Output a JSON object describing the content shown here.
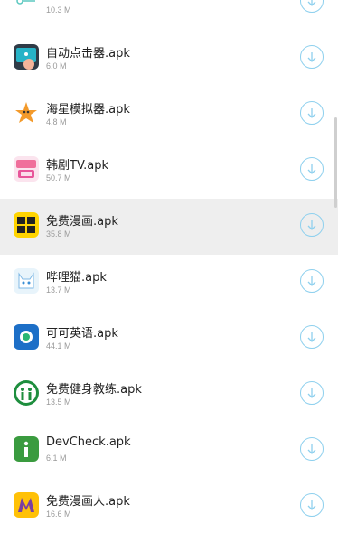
{
  "files": [
    {
      "name": "",
      "size": "10.3 M",
      "icon": "dots-icon"
    },
    {
      "name": "自动点击器.apk",
      "size": "6.0 M",
      "icon": "auto-clicker-icon"
    },
    {
      "name": "海星模拟器.apk",
      "size": "4.8 M",
      "icon": "starfish-icon"
    },
    {
      "name": "韩剧TV.apk",
      "size": "50.7 M",
      "icon": "korean-tv-icon"
    },
    {
      "name": "免费漫画.apk",
      "size": "35.8 M",
      "icon": "free-comics-icon"
    },
    {
      "name": "哔哩猫.apk",
      "size": "13.7 M",
      "icon": "bili-cat-icon"
    },
    {
      "name": "可可英语.apk",
      "size": "44.1 M",
      "icon": "keke-english-icon"
    },
    {
      "name": "免费健身教练.apk",
      "size": "13.5 M",
      "icon": "fitness-coach-icon"
    },
    {
      "name": "DevCheck.apk",
      "size": "6.1 M",
      "icon": "devcheck-icon"
    },
    {
      "name": "免费漫画人.apk",
      "size": "16.6 M",
      "icon": "manhuaren-icon"
    }
  ],
  "colors": {
    "accent": "#8ed0ee",
    "highlight_row": "#eeeeee"
  }
}
